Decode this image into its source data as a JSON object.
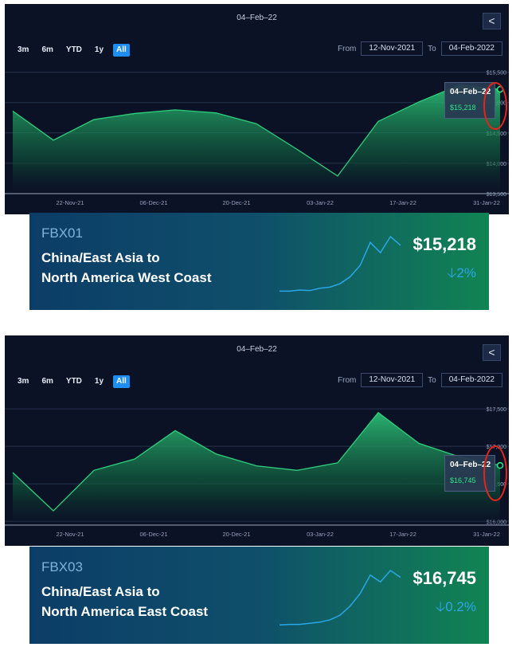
{
  "colors": {
    "panel_bg": "#0b1226",
    "line": "#2ecf7c",
    "tooltip_value": "#2ee686",
    "annotation_circle": "#e3241c",
    "range_active": "#1e8ef2",
    "banner_price_change": "#2ea6e8"
  },
  "charts": [
    {
      "header_date": "04–Feb–22",
      "share_icon": "share-icon",
      "range_buttons": [
        "3m",
        "6m",
        "YTD",
        "1y",
        "All"
      ],
      "active_range": "All",
      "from_label": "From",
      "from_value": "12-Nov-2021",
      "to_label": "To",
      "to_value": "04-Feb-2022",
      "tooltip": {
        "date": "04–Feb–22",
        "value": "$15,218"
      },
      "banner": {
        "code": "FBX01",
        "route_line1": "China/East Asia to",
        "route_line2": "North America West Coast",
        "price": "$15,218",
        "change": "2%",
        "change_direction": "down",
        "sparkline": [
          0.05,
          0.05,
          0.07,
          0.06,
          0.1,
          0.12,
          0.18,
          0.3,
          0.5,
          0.9,
          0.72,
          1.0,
          0.85
        ]
      }
    },
    {
      "header_date": "04–Feb–22",
      "share_icon": "share-icon",
      "range_buttons": [
        "3m",
        "6m",
        "YTD",
        "1y",
        "All"
      ],
      "active_range": "All",
      "from_label": "From",
      "from_value": "12-Nov-2021",
      "to_label": "To",
      "to_value": "04-Feb-2022",
      "tooltip": {
        "date": "04–Feb–22",
        "value": "$16,745"
      },
      "banner": {
        "code": "FBX03",
        "route_line1": "China/East Asia to",
        "route_line2": "North America East Coast",
        "price": "$16,745",
        "change": "0.2%",
        "change_direction": "down",
        "sparkline": [
          0.05,
          0.06,
          0.06,
          0.08,
          0.1,
          0.14,
          0.22,
          0.38,
          0.6,
          0.92,
          0.8,
          1.0,
          0.88
        ]
      }
    }
  ],
  "chart_data": [
    {
      "type": "area",
      "title": "04–Feb–22",
      "x_tick_labels": [
        "22-Nov-21",
        "06-Dec-21",
        "20-Dec-21",
        "03-Jan-22",
        "17-Jan-22",
        "31-Jan-22"
      ],
      "x": [
        "12-Nov-21",
        "18-Nov-21",
        "25-Nov-21",
        "02-Dec-21",
        "09-Dec-21",
        "16-Dec-21",
        "23-Dec-21",
        "30-Dec-21",
        "06-Jan-22",
        "13-Jan-22",
        "20-Jan-22",
        "27-Jan-22",
        "04-Feb-22"
      ],
      "values": [
        14860,
        14380,
        14720,
        14820,
        14880,
        14830,
        14650,
        14230,
        13790,
        14690,
        15010,
        15290,
        15218
      ],
      "y_tick_labels": [
        "$13,500",
        "$14,000",
        "$14,500",
        "$15,000",
        "$15,500"
      ],
      "ylim": [
        13500,
        15600
      ],
      "grid": true,
      "legend": "none"
    },
    {
      "type": "area",
      "title": "04–Feb–22",
      "x_tick_labels": [
        "22-Nov-21",
        "06-Dec-21",
        "20-Dec-21",
        "03-Jan-22",
        "17-Jan-22",
        "31-Jan-22"
      ],
      "x": [
        "12-Nov-21",
        "18-Nov-21",
        "25-Nov-21",
        "02-Dec-21",
        "09-Dec-21",
        "16-Dec-21",
        "23-Dec-21",
        "30-Dec-21",
        "06-Jan-22",
        "13-Jan-22",
        "20-Jan-22",
        "27-Jan-22",
        "04-Feb-22"
      ],
      "values": [
        16650,
        16140,
        16680,
        16830,
        17210,
        16900,
        16740,
        16680,
        16780,
        17450,
        17040,
        16860,
        16745
      ],
      "y_tick_labels": [
        "$16,000",
        "$16,500",
        "$17,000",
        "$17,500"
      ],
      "ylim": [
        15950,
        17650
      ],
      "grid": true,
      "legend": "none"
    }
  ]
}
